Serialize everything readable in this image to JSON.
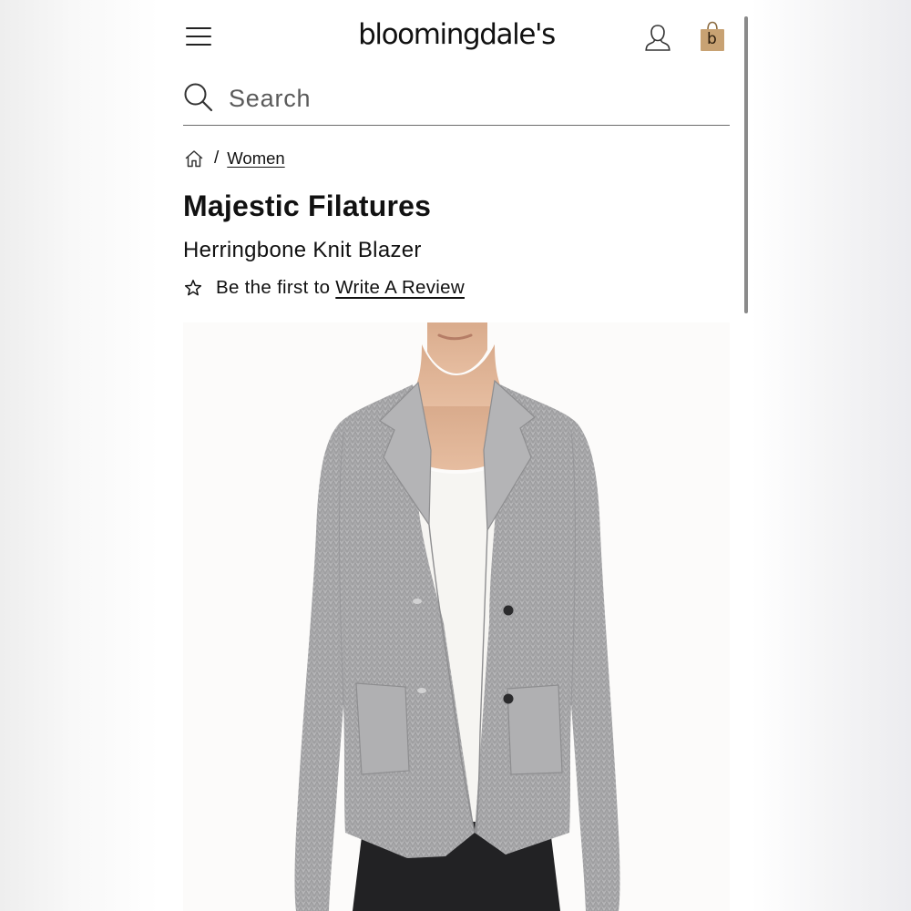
{
  "header": {
    "logo_text": "bloomingdale's",
    "menu_icon": "hamburger-menu-icon",
    "account_icon": "user-account-icon",
    "bag_icon": "shopping-bag-icon",
    "bag_letter": "b",
    "bag_color": "#c8a273"
  },
  "search": {
    "placeholder": "Search",
    "value": ""
  },
  "breadcrumb": {
    "home_icon": "home-icon",
    "separator": "/",
    "category": "Women"
  },
  "product": {
    "brand": "Majestic Filatures",
    "name": "Herringbone Knit Blazer",
    "review_prefix": "Be the first to",
    "review_link": "Write A Review",
    "image_alt": "Herringbone Knit Blazer",
    "blazer_color": "#a9a9ab",
    "top_color": "#f6f5f2"
  }
}
